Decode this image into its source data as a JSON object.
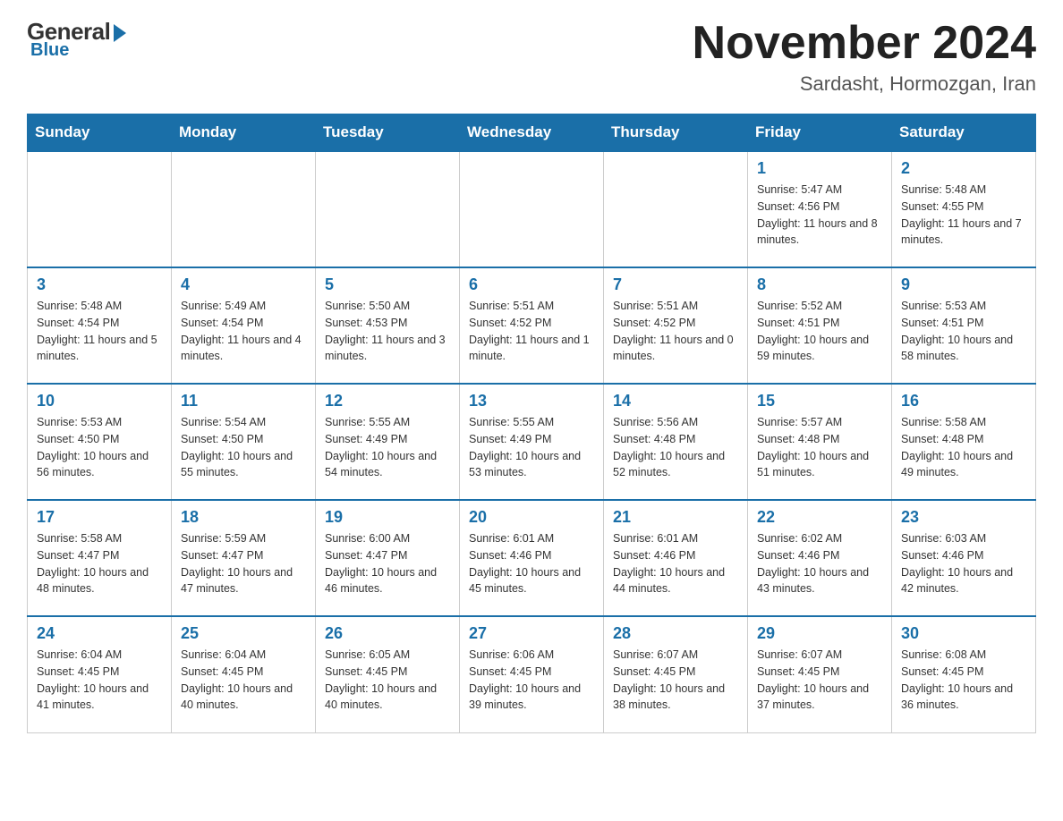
{
  "logo": {
    "general": "General",
    "blue": "Blue"
  },
  "header": {
    "month": "November 2024",
    "location": "Sardasht, Hormozgan, Iran"
  },
  "weekdays": [
    "Sunday",
    "Monday",
    "Tuesday",
    "Wednesday",
    "Thursday",
    "Friday",
    "Saturday"
  ],
  "weeks": [
    [
      {
        "day": "",
        "info": ""
      },
      {
        "day": "",
        "info": ""
      },
      {
        "day": "",
        "info": ""
      },
      {
        "day": "",
        "info": ""
      },
      {
        "day": "",
        "info": ""
      },
      {
        "day": "1",
        "info": "Sunrise: 5:47 AM\nSunset: 4:56 PM\nDaylight: 11 hours and 8 minutes."
      },
      {
        "day": "2",
        "info": "Sunrise: 5:48 AM\nSunset: 4:55 PM\nDaylight: 11 hours and 7 minutes."
      }
    ],
    [
      {
        "day": "3",
        "info": "Sunrise: 5:48 AM\nSunset: 4:54 PM\nDaylight: 11 hours and 5 minutes."
      },
      {
        "day": "4",
        "info": "Sunrise: 5:49 AM\nSunset: 4:54 PM\nDaylight: 11 hours and 4 minutes."
      },
      {
        "day": "5",
        "info": "Sunrise: 5:50 AM\nSunset: 4:53 PM\nDaylight: 11 hours and 3 minutes."
      },
      {
        "day": "6",
        "info": "Sunrise: 5:51 AM\nSunset: 4:52 PM\nDaylight: 11 hours and 1 minute."
      },
      {
        "day": "7",
        "info": "Sunrise: 5:51 AM\nSunset: 4:52 PM\nDaylight: 11 hours and 0 minutes."
      },
      {
        "day": "8",
        "info": "Sunrise: 5:52 AM\nSunset: 4:51 PM\nDaylight: 10 hours and 59 minutes."
      },
      {
        "day": "9",
        "info": "Sunrise: 5:53 AM\nSunset: 4:51 PM\nDaylight: 10 hours and 58 minutes."
      }
    ],
    [
      {
        "day": "10",
        "info": "Sunrise: 5:53 AM\nSunset: 4:50 PM\nDaylight: 10 hours and 56 minutes."
      },
      {
        "day": "11",
        "info": "Sunrise: 5:54 AM\nSunset: 4:50 PM\nDaylight: 10 hours and 55 minutes."
      },
      {
        "day": "12",
        "info": "Sunrise: 5:55 AM\nSunset: 4:49 PM\nDaylight: 10 hours and 54 minutes."
      },
      {
        "day": "13",
        "info": "Sunrise: 5:55 AM\nSunset: 4:49 PM\nDaylight: 10 hours and 53 minutes."
      },
      {
        "day": "14",
        "info": "Sunrise: 5:56 AM\nSunset: 4:48 PM\nDaylight: 10 hours and 52 minutes."
      },
      {
        "day": "15",
        "info": "Sunrise: 5:57 AM\nSunset: 4:48 PM\nDaylight: 10 hours and 51 minutes."
      },
      {
        "day": "16",
        "info": "Sunrise: 5:58 AM\nSunset: 4:48 PM\nDaylight: 10 hours and 49 minutes."
      }
    ],
    [
      {
        "day": "17",
        "info": "Sunrise: 5:58 AM\nSunset: 4:47 PM\nDaylight: 10 hours and 48 minutes."
      },
      {
        "day": "18",
        "info": "Sunrise: 5:59 AM\nSunset: 4:47 PM\nDaylight: 10 hours and 47 minutes."
      },
      {
        "day": "19",
        "info": "Sunrise: 6:00 AM\nSunset: 4:47 PM\nDaylight: 10 hours and 46 minutes."
      },
      {
        "day": "20",
        "info": "Sunrise: 6:01 AM\nSunset: 4:46 PM\nDaylight: 10 hours and 45 minutes."
      },
      {
        "day": "21",
        "info": "Sunrise: 6:01 AM\nSunset: 4:46 PM\nDaylight: 10 hours and 44 minutes."
      },
      {
        "day": "22",
        "info": "Sunrise: 6:02 AM\nSunset: 4:46 PM\nDaylight: 10 hours and 43 minutes."
      },
      {
        "day": "23",
        "info": "Sunrise: 6:03 AM\nSunset: 4:46 PM\nDaylight: 10 hours and 42 minutes."
      }
    ],
    [
      {
        "day": "24",
        "info": "Sunrise: 6:04 AM\nSunset: 4:45 PM\nDaylight: 10 hours and 41 minutes."
      },
      {
        "day": "25",
        "info": "Sunrise: 6:04 AM\nSunset: 4:45 PM\nDaylight: 10 hours and 40 minutes."
      },
      {
        "day": "26",
        "info": "Sunrise: 6:05 AM\nSunset: 4:45 PM\nDaylight: 10 hours and 40 minutes."
      },
      {
        "day": "27",
        "info": "Sunrise: 6:06 AM\nSunset: 4:45 PM\nDaylight: 10 hours and 39 minutes."
      },
      {
        "day": "28",
        "info": "Sunrise: 6:07 AM\nSunset: 4:45 PM\nDaylight: 10 hours and 38 minutes."
      },
      {
        "day": "29",
        "info": "Sunrise: 6:07 AM\nSunset: 4:45 PM\nDaylight: 10 hours and 37 minutes."
      },
      {
        "day": "30",
        "info": "Sunrise: 6:08 AM\nSunset: 4:45 PM\nDaylight: 10 hours and 36 minutes."
      }
    ]
  ]
}
